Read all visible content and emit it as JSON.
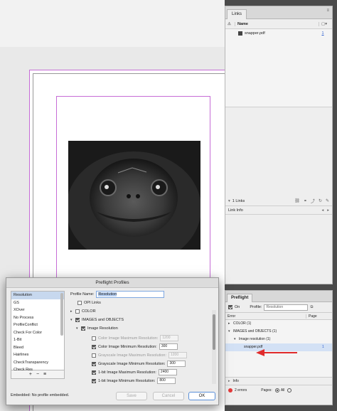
{
  "links_panel": {
    "tab": "Links",
    "columns": {
      "name": "Name"
    },
    "items": [
      {
        "name": "snapper.pdf",
        "page": "1"
      }
    ],
    "count": "1 Links",
    "link_info": "Link Info"
  },
  "dialog": {
    "title": "Preflight Profiles",
    "profiles": [
      "Resolution",
      "GS",
      "XOver",
      "No Process",
      "ProfileConflict",
      "Check For Color",
      "1-Bit",
      "Bleed",
      "Hairlines",
      "CheckTransparency",
      "Check Res"
    ],
    "selected_profile": "Resolution",
    "profile_name_label": "Profile Name:",
    "profile_name_value": "Resolution",
    "options": {
      "opi_links": "OPI Links",
      "color": "COLOR",
      "images_objects": "IMAGES and OBJECTS",
      "image_resolution": "Image Resolution",
      "color_max": "Color Image Maximum Resolution:",
      "color_max_value": "1200",
      "color_min": "Color Image Minimum Resolution:",
      "color_min_value": "300",
      "gray_max": "Grayscale Image Maximum Resolution:",
      "gray_max_value": "1200",
      "gray_min": "Grayscale Image Minimum Resolution:",
      "gray_min_value": "300",
      "bit_max": "1-bit Image Maximum Resolution:",
      "bit_max_value": "2400",
      "bit_min": "1-bit Image Minimum Resolution:",
      "bit_min_value": "800"
    },
    "list_buttons": {
      "add": "+",
      "remove": "−",
      "menu": "≡"
    },
    "embedded": "Embedded: No profile embedded.",
    "buttons": {
      "save": "Save",
      "cancel": "Cancel",
      "ok": "OK"
    }
  },
  "preflight_panel": {
    "tab": "Preflight",
    "on_label": "On",
    "profile_label": "Profile:",
    "profile_value": "Resolution",
    "columns": {
      "error": "Error",
      "page": "Page"
    },
    "tree": {
      "color": "COLOR (1)",
      "images_objects": "IMAGES and OBJECTS (1)",
      "image_resolution": "Image resolution (1)",
      "file": "snapper.pdf",
      "file_page": "1"
    },
    "info": "Info",
    "errors": "2 errors",
    "pages_label": "Pages:",
    "all_label": "All"
  },
  "colors": {
    "accent_error": "#e23a3a",
    "selection": "#c7d8ee",
    "link_blue": "#2e5fd1",
    "margin_guide": "#c66cd6"
  }
}
